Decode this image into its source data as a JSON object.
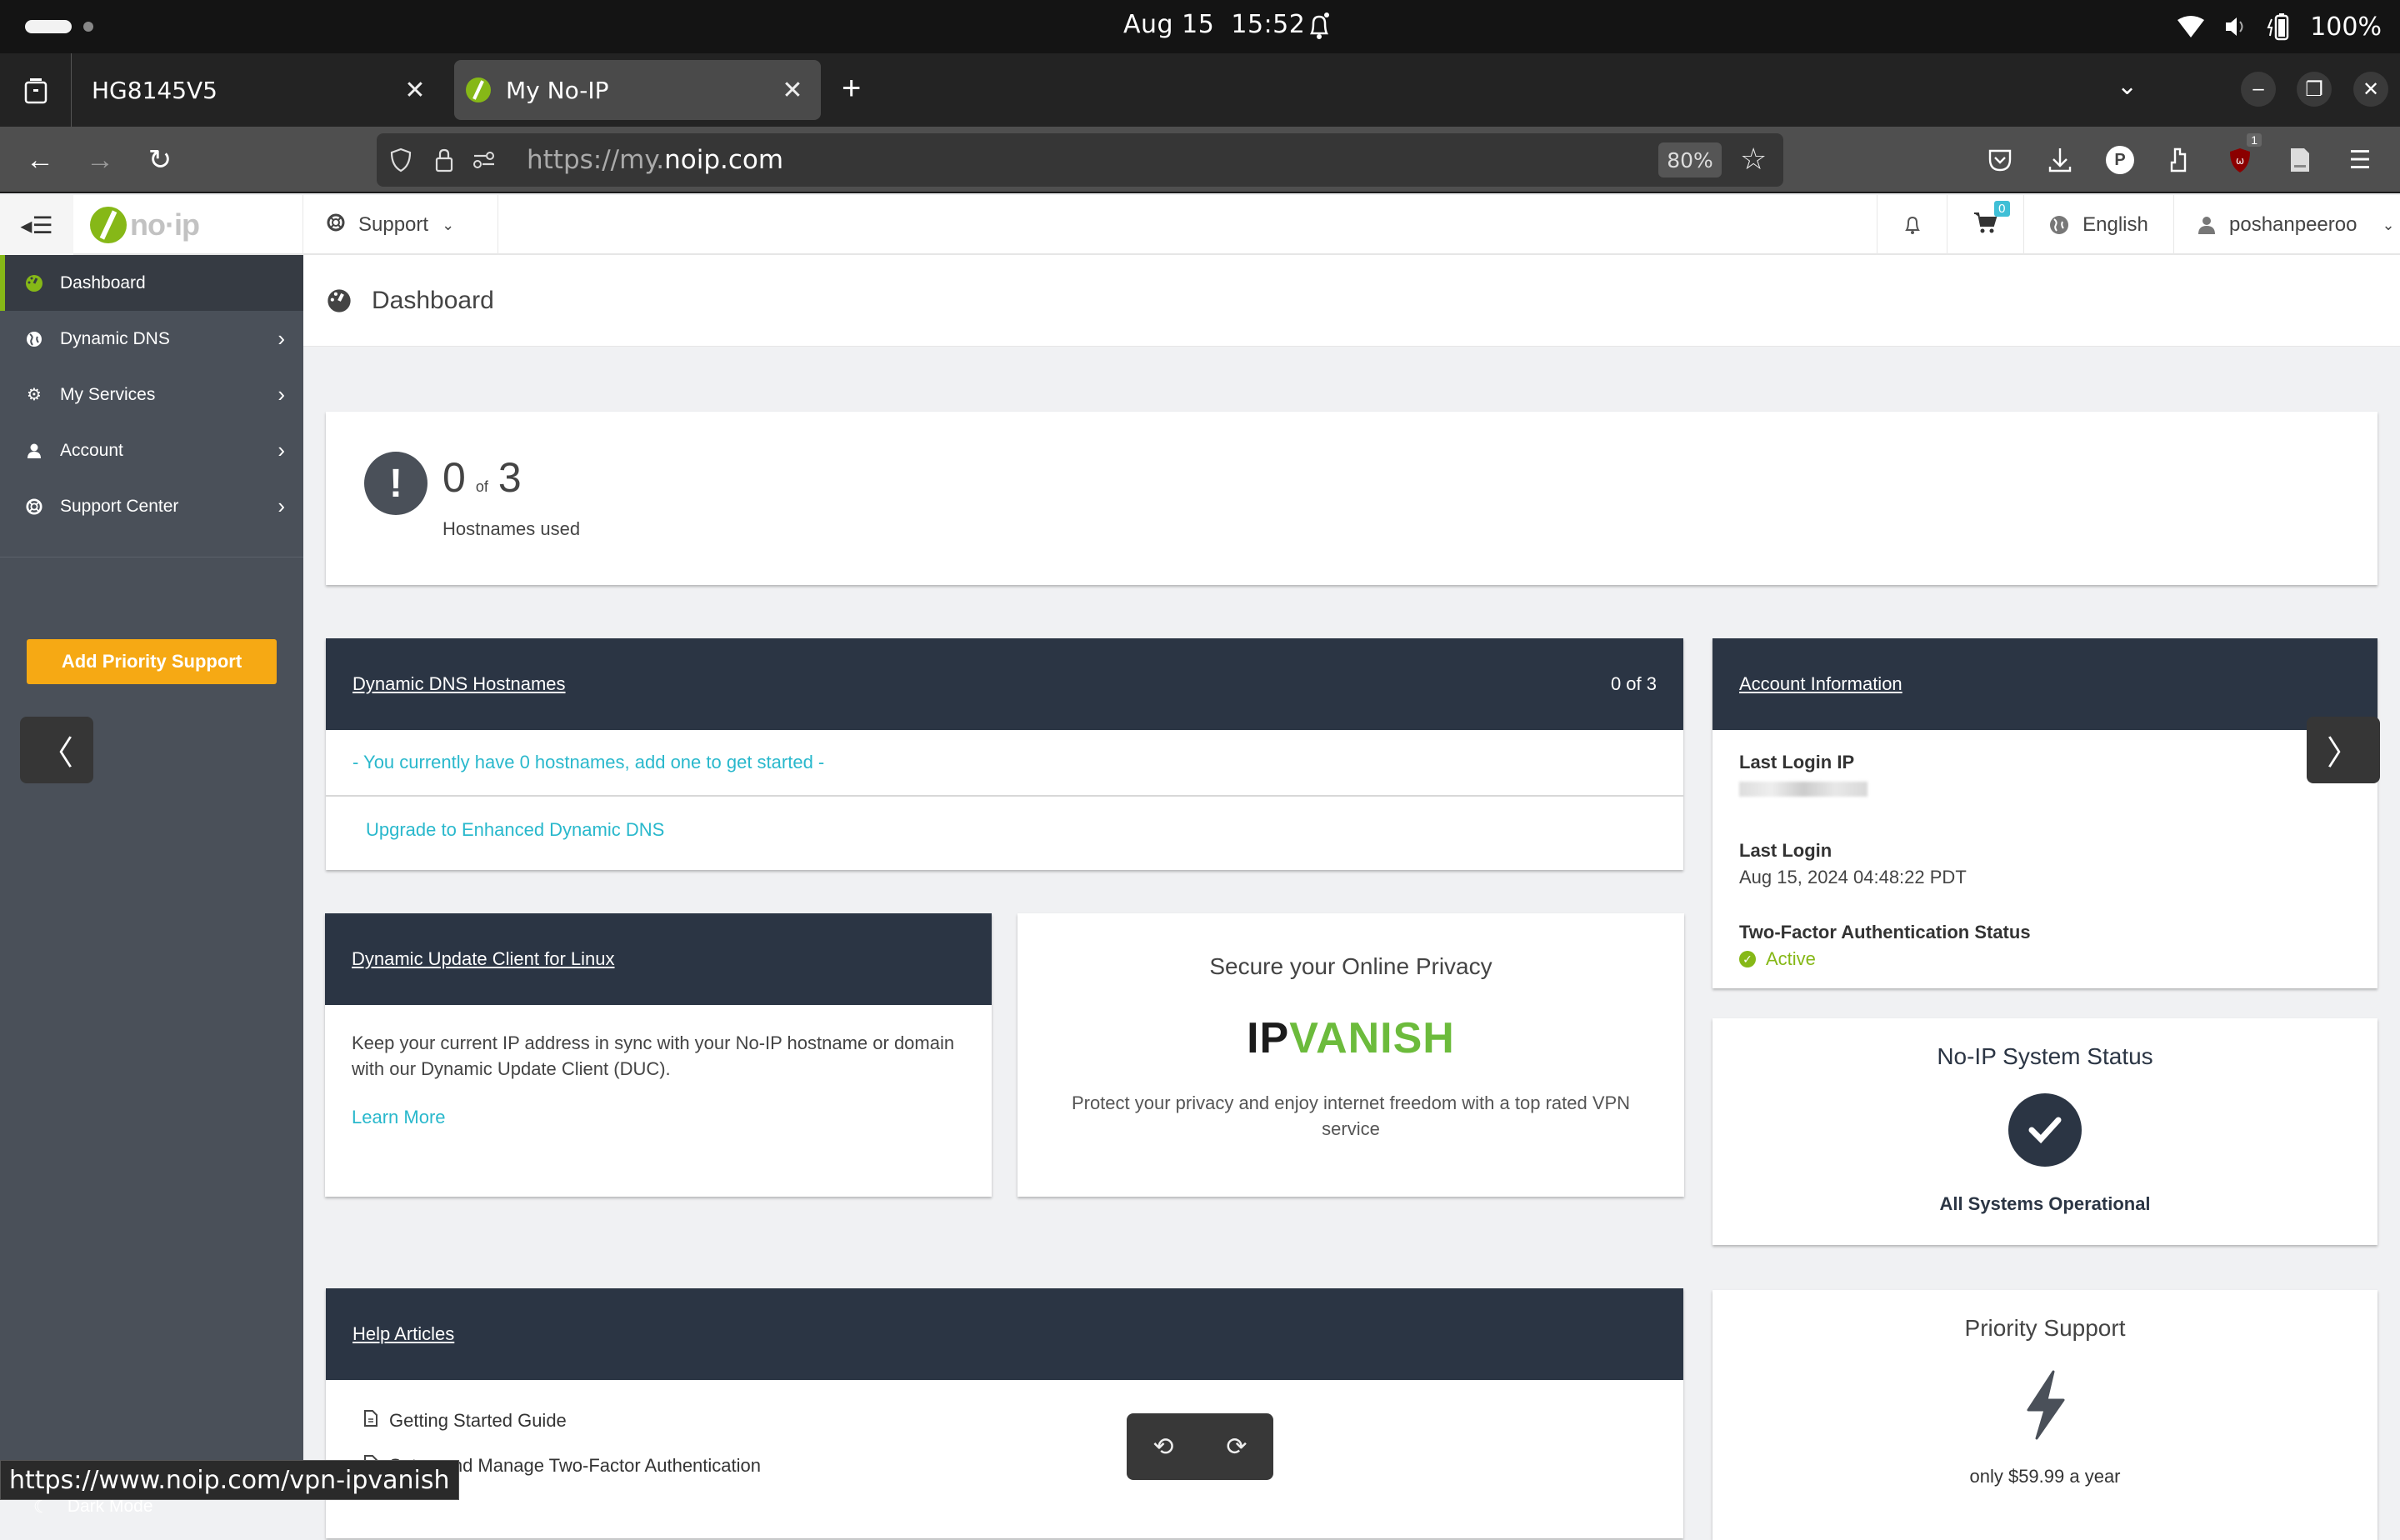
{
  "os": {
    "date": "Aug 15",
    "time": "15:52",
    "battery": "100%"
  },
  "browser": {
    "tabs": [
      {
        "title": "HG8145V5",
        "active": false
      },
      {
        "title": "My No-IP",
        "active": true
      }
    ],
    "url_prefix": "https://my.",
    "url_domain": "noip.com",
    "zoom": "80%",
    "extension_badge": "1",
    "status_url": "https://www.noip.com/vpn-ipvanish"
  },
  "header": {
    "logo_text": "no·ip",
    "support_label": "Support",
    "cart_count": "0",
    "language": "English",
    "username": "poshanpeeroo"
  },
  "sidebar": {
    "items": [
      {
        "label": "Dashboard",
        "icon": "dashboard-icon",
        "active": true
      },
      {
        "label": "Dynamic DNS",
        "icon": "globe-icon"
      },
      {
        "label": "My Services",
        "icon": "gear-icon"
      },
      {
        "label": "Account",
        "icon": "user-icon"
      },
      {
        "label": "Support Center",
        "icon": "lifebuoy-icon"
      }
    ],
    "priority_button": "Add Priority Support",
    "dark_mode": "Dark Mode"
  },
  "page": {
    "title": "Dashboard"
  },
  "hostnames_summary": {
    "used": "0",
    "of_word": "of",
    "total": "3",
    "label": "Hostnames used"
  },
  "ddns_card": {
    "title": "Dynamic DNS Hostnames",
    "count": "0 of 3",
    "empty_message": "- You currently have 0 hostnames, add one to get started -",
    "upgrade_link": "Upgrade to Enhanced Dynamic DNS"
  },
  "account_card": {
    "title": "Account Information",
    "last_login_ip_label": "Last Login IP",
    "last_login_label": "Last Login",
    "last_login_value": "Aug 15, 2024 04:48:22 PDT",
    "two_factor_label": "Two-Factor Authentication Status",
    "two_factor_value": "Active"
  },
  "duc_card": {
    "title": "Dynamic Update Client for Linux",
    "body": "Keep your current IP address in sync with your No-IP hostname or domain with our Dynamic Update Client (DUC).",
    "link": "Learn More"
  },
  "vpn_card": {
    "title": "Secure your Online Privacy",
    "brand_ip": "IP",
    "brand_vanish": "VANISH",
    "body": "Protect your privacy and enjoy internet freedom with a top rated VPN service"
  },
  "system_status": {
    "title": "No-IP System Status",
    "status": "All Systems Operational"
  },
  "help_articles": {
    "title": "Help Articles",
    "items": [
      "Getting Started Guide",
      "Setup and Manage Two-Factor Authentication"
    ]
  },
  "priority_support": {
    "title": "Priority Support",
    "price": "only $59.99 a year"
  },
  "colors": {
    "brand_green": "#86b817",
    "accent_teal": "#29b8cc",
    "button_orange": "#f6a914",
    "card_header": "#2b3544",
    "sidebar_bg": "#4a5059"
  }
}
